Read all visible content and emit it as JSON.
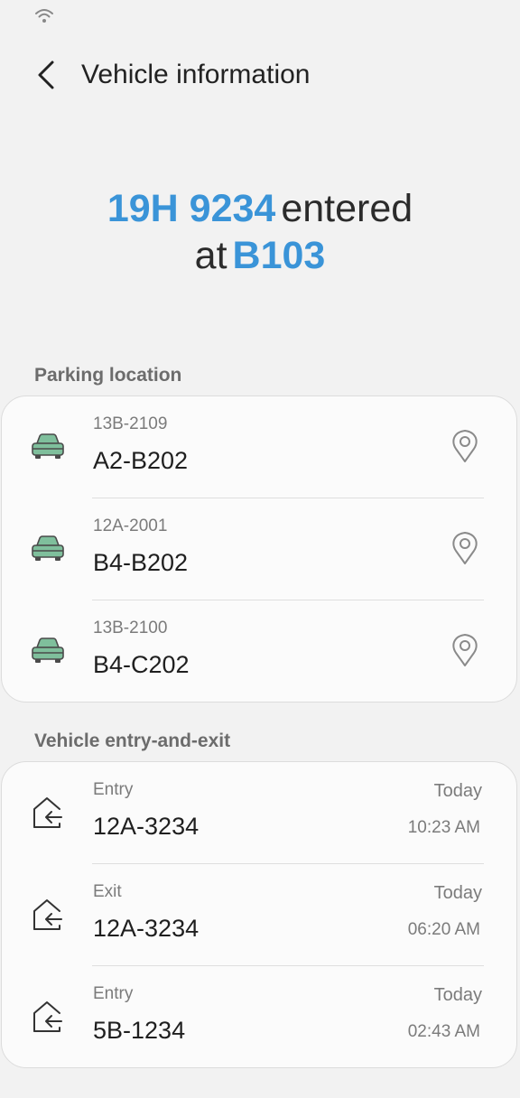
{
  "header": {
    "title": "Vehicle information",
    "back_icon": "chevron-left-icon"
  },
  "hero": {
    "plate": "19H 9234",
    "verb": "entered",
    "at": "at",
    "location": "B103",
    "highlight_color": "#3a94d8"
  },
  "parking": {
    "label": "Parking location",
    "items": [
      {
        "code": "13B-2109",
        "spot": "A2-B202"
      },
      {
        "code": "12A-2001",
        "spot": "B4-B202"
      },
      {
        "code": "13B-2100",
        "spot": "B4-C202"
      }
    ]
  },
  "entries": {
    "label": "Vehicle entry-and-exit",
    "items": [
      {
        "type": "Entry",
        "plate": "12A-3234",
        "day": "Today",
        "time": "10:23 AM"
      },
      {
        "type": "Exit",
        "plate": "12A-3234",
        "day": "Today",
        "time": "06:20 AM"
      },
      {
        "type": "Entry",
        "plate": "5B-1234",
        "day": "Today",
        "time": "02:43 AM"
      }
    ]
  },
  "colors": {
    "car_fill": "#7fbf9c",
    "icon_stroke": "#4a4a4a"
  }
}
